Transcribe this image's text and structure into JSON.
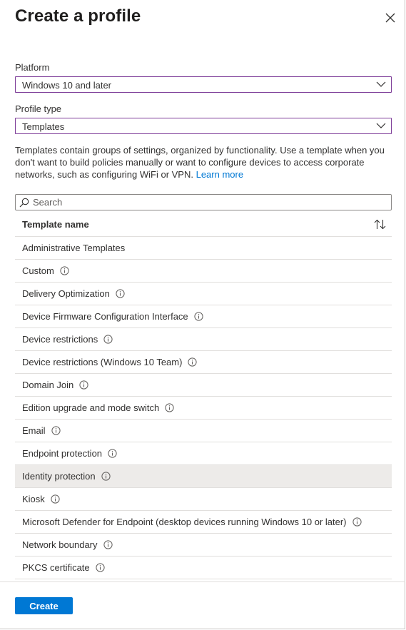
{
  "header": {
    "title": "Create a profile",
    "close_icon": "close-icon"
  },
  "platform": {
    "label": "Platform",
    "value": "Windows 10 and later"
  },
  "profile_type": {
    "label": "Profile type",
    "value": "Templates"
  },
  "description": {
    "text": "Templates contain groups of settings, organized by functionality. Use a template when you don't want to build policies manually or want to configure devices to access corporate networks, such as configuring WiFi or VPN. ",
    "link": "Learn more"
  },
  "search": {
    "placeholder": "Search",
    "value": ""
  },
  "table": {
    "column_header": "Template name",
    "rows": [
      {
        "name": "Administrative Templates",
        "info": false,
        "selected": false
      },
      {
        "name": "Custom",
        "info": true,
        "selected": false
      },
      {
        "name": "Delivery Optimization",
        "info": true,
        "selected": false
      },
      {
        "name": "Device Firmware Configuration Interface",
        "info": true,
        "selected": false
      },
      {
        "name": "Device restrictions",
        "info": true,
        "selected": false
      },
      {
        "name": "Device restrictions (Windows 10 Team)",
        "info": true,
        "selected": false
      },
      {
        "name": "Domain Join",
        "info": true,
        "selected": false
      },
      {
        "name": "Edition upgrade and mode switch",
        "info": true,
        "selected": false
      },
      {
        "name": "Email",
        "info": true,
        "selected": false
      },
      {
        "name": "Endpoint protection",
        "info": true,
        "selected": false
      },
      {
        "name": "Identity protection",
        "info": true,
        "selected": true
      },
      {
        "name": "Kiosk",
        "info": true,
        "selected": false
      },
      {
        "name": "Microsoft Defender for Endpoint (desktop devices running Windows 10 or later)",
        "info": true,
        "selected": false
      },
      {
        "name": "Network boundary",
        "info": true,
        "selected": false
      },
      {
        "name": "PKCS certificate",
        "info": true,
        "selected": false
      }
    ]
  },
  "footer": {
    "create_label": "Create"
  },
  "colors": {
    "accent": "#0078d4",
    "focus_border": "#7d3c98",
    "selected_row": "#edebe9"
  }
}
